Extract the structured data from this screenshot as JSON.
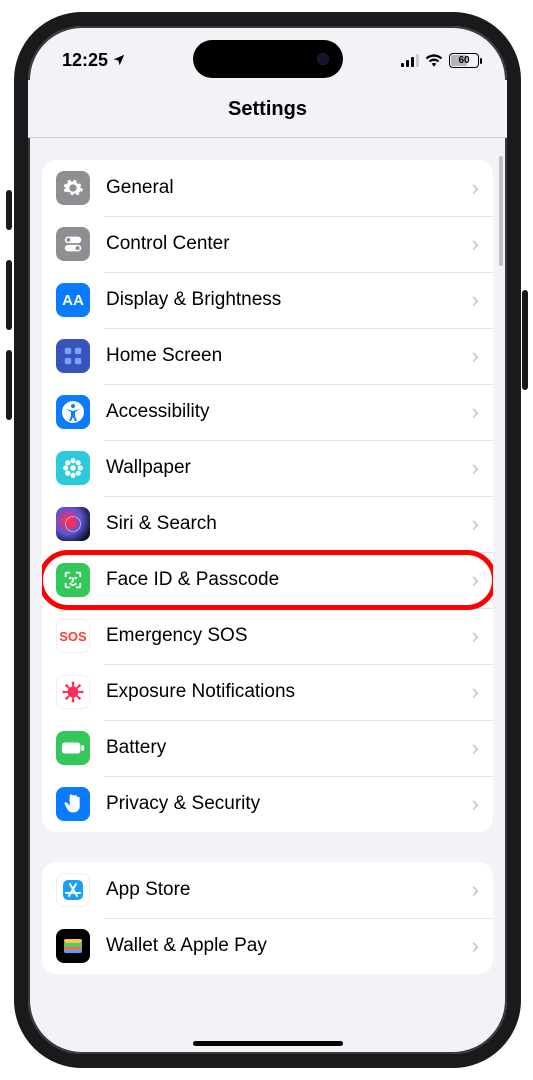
{
  "status": {
    "time": "12:25",
    "battery_percent": "60"
  },
  "header": {
    "title": "Settings"
  },
  "groups": [
    {
      "items": [
        {
          "id": "general",
          "label": "General",
          "icon": "gear-icon",
          "icon_class": "ic-general",
          "highlighted": false
        },
        {
          "id": "control-center",
          "label": "Control Center",
          "icon": "toggles-icon",
          "icon_class": "ic-cc",
          "highlighted": false
        },
        {
          "id": "display",
          "label": "Display & Brightness",
          "icon": "text-size-icon",
          "icon_class": "ic-display",
          "highlighted": false
        },
        {
          "id": "home-screen",
          "label": "Home Screen",
          "icon": "grid-icon",
          "icon_class": "ic-home",
          "highlighted": false
        },
        {
          "id": "accessibility",
          "label": "Accessibility",
          "icon": "accessibility-icon",
          "icon_class": "ic-access",
          "highlighted": false
        },
        {
          "id": "wallpaper",
          "label": "Wallpaper",
          "icon": "flower-icon",
          "icon_class": "ic-wall",
          "highlighted": false
        },
        {
          "id": "siri",
          "label": "Siri & Search",
          "icon": "siri-icon",
          "icon_class": "ic-siri",
          "highlighted": false
        },
        {
          "id": "face-id",
          "label": "Face ID & Passcode",
          "icon": "face-id-icon",
          "icon_class": "ic-face",
          "highlighted": true
        },
        {
          "id": "sos",
          "label": "Emergency SOS",
          "icon": "sos-icon",
          "icon_class": "ic-sos",
          "highlighted": false
        },
        {
          "id": "exposure",
          "label": "Exposure Notifications",
          "icon": "virus-icon",
          "icon_class": "ic-expo",
          "highlighted": false
        },
        {
          "id": "battery",
          "label": "Battery",
          "icon": "battery-icon",
          "icon_class": "ic-batt",
          "highlighted": false
        },
        {
          "id": "privacy",
          "label": "Privacy & Security",
          "icon": "hand-icon",
          "icon_class": "ic-priv",
          "highlighted": false
        }
      ]
    },
    {
      "items": [
        {
          "id": "app-store",
          "label": "App Store",
          "icon": "appstore-icon",
          "icon_class": "ic-store",
          "highlighted": false
        },
        {
          "id": "wallet",
          "label": "Wallet & Apple Pay",
          "icon": "wallet-icon",
          "icon_class": "ic-wallet",
          "highlighted": false
        }
      ]
    }
  ],
  "annotation": {
    "highlight_color": "#ff0000"
  }
}
